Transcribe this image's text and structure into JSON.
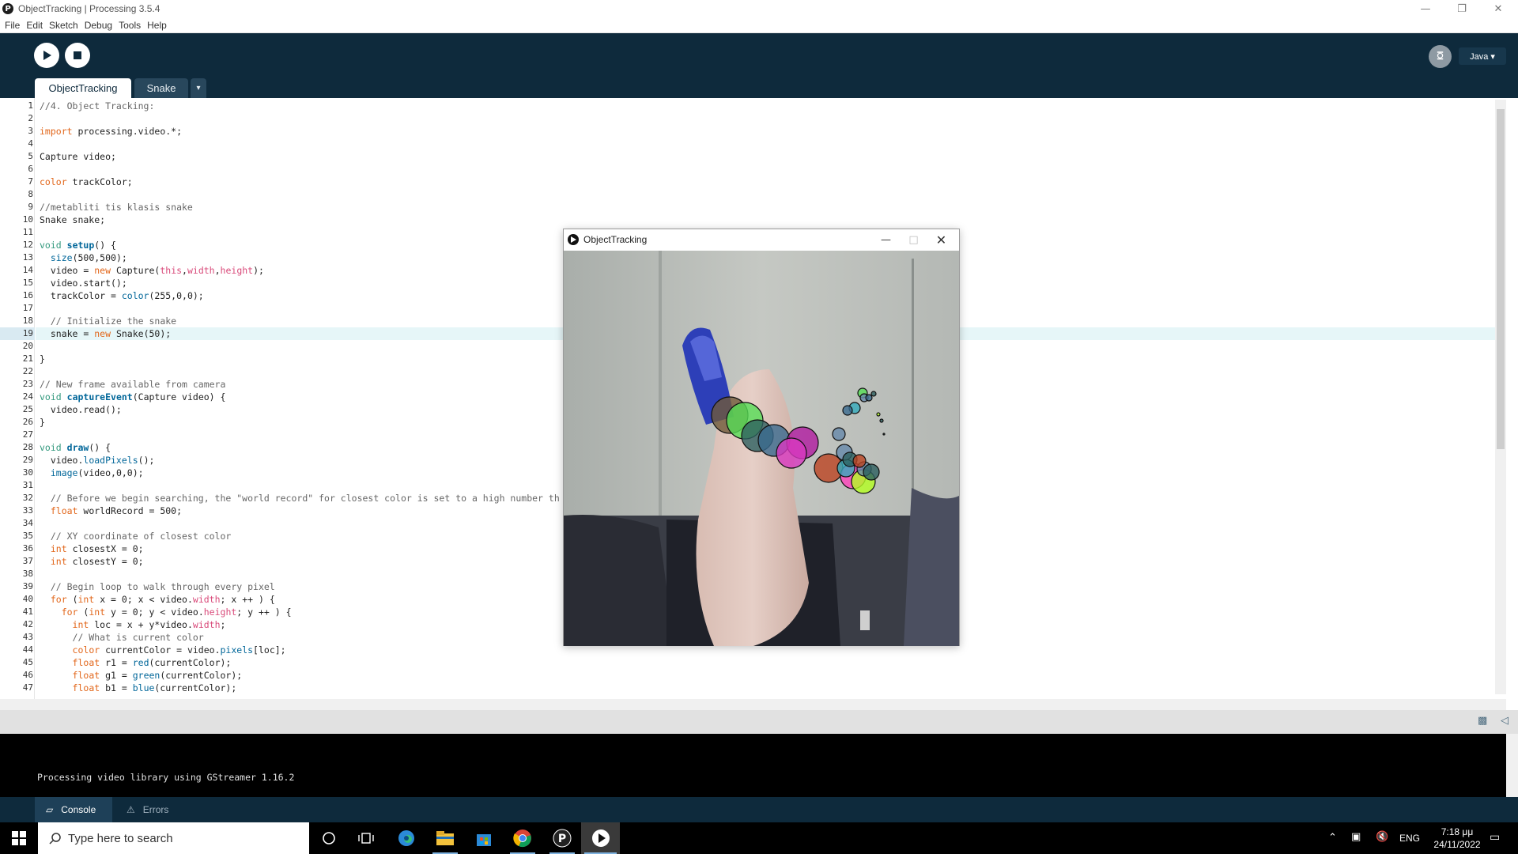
{
  "window": {
    "title": "ObjectTracking | Processing 3.5.4",
    "app_icon_glyph": "P",
    "controls": [
      "minimize-icon",
      "maximize-icon",
      "close-icon"
    ]
  },
  "menu": [
    "File",
    "Edit",
    "Sketch",
    "Debug",
    "Tools",
    "Help"
  ],
  "toolbar": {
    "run": "play-icon",
    "stop": "stop-icon",
    "mode": "Java ▾",
    "debug_icon_glyph": "ꗞ"
  },
  "tabs": [
    "ObjectTracking",
    "Snake"
  ],
  "tab_menu_arrow": "▾",
  "editor": {
    "current_line": 19,
    "lines": [
      "//4. Object Tracking:",
      "",
      "import processing.video.*;",
      "",
      "Capture video;",
      "",
      "color trackColor;",
      "",
      "//metabliti tis klasis snake",
      "Snake snake;",
      "",
      "void setup() {",
      "  size(500,500);",
      "  video = new Capture(this,width,height);",
      "  video.start();",
      "  trackColor = color(255,0,0);",
      "",
      "  // Initialize the snake",
      "  snake = new Snake(50);",
      "",
      "}",
      "",
      "// New frame available from camera",
      "void captureEvent(Capture video) {",
      "  video.read();",
      "}",
      "",
      "void draw() {",
      "  video.loadPixels();",
      "  image(video,0,0);",
      "",
      "  // Before we begin searching, the \"world record\" for closest color is set to a high number th",
      "  float worldRecord = 500;",
      "",
      "  // XY coordinate of closest color",
      "  int closestX = 0;",
      "  int closestY = 0;",
      "",
      "  // Begin loop to walk through every pixel",
      "  for (int x = 0; x < video.width; x ++ ) {",
      "    for (int y = 0; y < video.height; y ++ ) {",
      "      int loc = x + y*video.width;",
      "      // What is current color",
      "      color currentColor = video.pixels[loc];",
      "      float r1 = red(currentColor);",
      "      float g1 = green(currentColor);",
      "      float b1 = blue(currentColor);"
    ]
  },
  "console": {
    "output": "Processing video library using GStreamer 1.16.2",
    "tabs": [
      "Console",
      "Errors"
    ]
  },
  "sketch_window": {
    "title": "ObjectTracking",
    "controls": [
      "minimize-icon",
      "maximize-icon",
      "close-icon"
    ],
    "snake_colors": [
      "#6f5a3a",
      "#55dd55",
      "#2d5f5f",
      "#3a6a8e",
      "#b01aa0",
      "#d838c0",
      "#bb4422",
      "#ff44bb",
      "#b4ff22",
      "#33aabb",
      "#6688aa"
    ]
  },
  "taskbar": {
    "search_placeholder": "Type here to search",
    "lang": "ENG",
    "time": "7:18 μμ",
    "date": "24/11/2022"
  }
}
